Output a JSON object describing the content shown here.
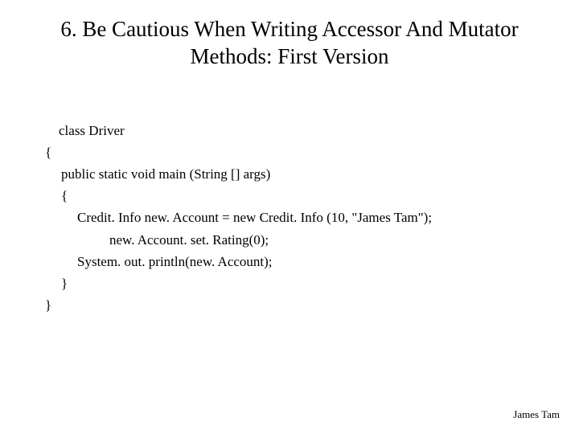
{
  "title": "6. Be Cautious When Writing Accessor And Mutator Methods: First Version",
  "code": {
    "l1": "class Driver",
    "l2": "{",
    "l3": "public static void main (String [] args)",
    "l4": "{",
    "l5": "Credit. Info new. Account = new Credit. Info (10, \"James Tam\");",
    "l6": "new. Account. set. Rating(0);",
    "l7": "System. out. println(new. Account);",
    "l8": "}",
    "l9": "}"
  },
  "footer": "James Tam"
}
